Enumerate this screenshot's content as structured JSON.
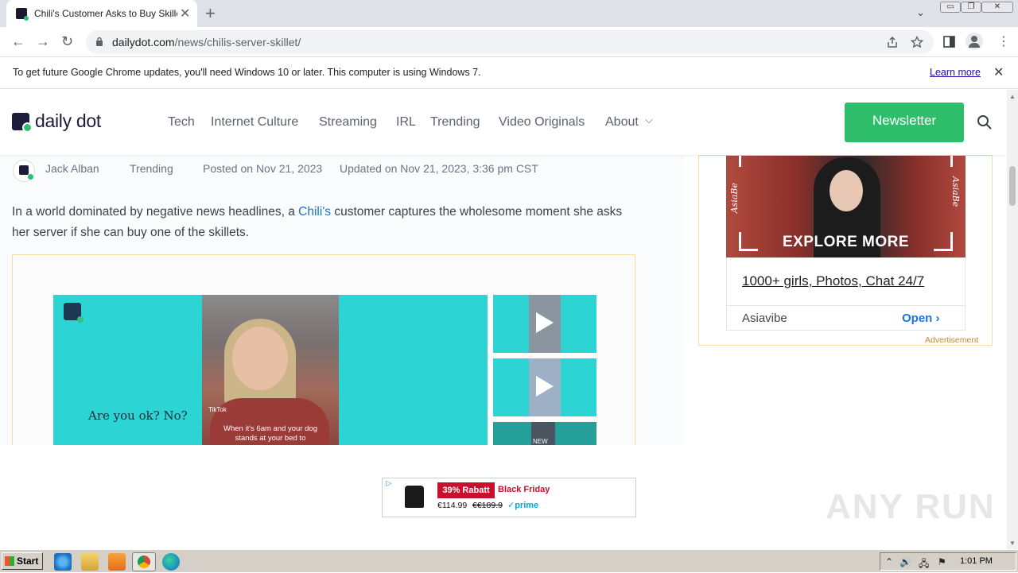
{
  "browser": {
    "tab_title": "Chili's Customer Asks to Buy Skillet A",
    "new_tab": "+",
    "tab_close": "✕",
    "tab_search": "⌄",
    "window_controls": [
      "▭",
      "❐",
      "✕"
    ],
    "nav": {
      "back": "←",
      "forward": "→",
      "reload": "↻"
    },
    "url_host": "dailydot.com",
    "url_path": "/news/chilis-server-skillet/",
    "toolbar_icons": [
      "share-icon",
      "star-icon",
      "sidepanel-icon",
      "profile-icon",
      "menu-icon"
    ],
    "menu": "⋮"
  },
  "infobar": {
    "message": "To get future Google Chrome updates, you'll need Windows 10 or later. This computer is using Windows 7.",
    "learn_more": "Learn more",
    "close": "✕"
  },
  "site": {
    "logo_text": "daily dot",
    "nav": [
      "Tech",
      "Internet Culture",
      "Streaming",
      "IRL",
      "Trending",
      "Video Originals",
      "About"
    ],
    "about_caret": "⌵",
    "newsletter": "Newsletter",
    "accent_color": "#2ebd6b"
  },
  "article": {
    "author": "Jack Alban",
    "category": "Trending",
    "posted": "Posted on Nov 21, 2023",
    "updated": "Updated on Nov 21, 2023, 3:36 pm CST",
    "lede_before": "In a world dominated by negative news headlines, a ",
    "lede_link": "Chili's",
    "lede_after": " customer captures the wholesome moment she asks her server if she can buy one of the skillets."
  },
  "video": {
    "caption": "Are you ok? No?",
    "subtitle": "When it's 6am and your dog stands at your bed to",
    "tiktok": "TikTok",
    "thumb3_text": "NEW"
  },
  "sidebar_ad": {
    "explore": "EXPLORE MORE",
    "brand": "AsiaBe",
    "headline": "1000+ girls, Photos, Chat 24/7",
    "advertiser": "Asiavibe",
    "open": "Open",
    "chevron": "›",
    "label": "Advertisement"
  },
  "banner_ad": {
    "adchoices": "▷",
    "badge": "39% Rabatt",
    "title": "Black Friday",
    "price": "€114.99",
    "old_price": "€€189.9",
    "prime": "✓prime"
  },
  "watermark": "ANY RUN",
  "taskbar": {
    "start": "Start",
    "clock": "1:01 PM",
    "tray_icons": [
      "⌃",
      "🔊",
      "🖧",
      "⚑"
    ]
  }
}
